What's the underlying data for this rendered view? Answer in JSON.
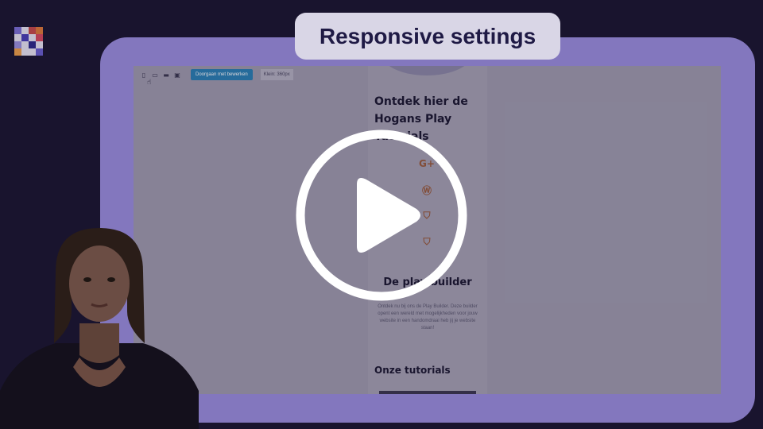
{
  "title": "Responsive settings",
  "toolbar": {
    "icons": [
      "mobile-icon",
      "tablet-icon",
      "laptop-icon",
      "desktop-icon"
    ],
    "continue_label": "Doorgaan met bewerken",
    "width_label": "Klein: 360px"
  },
  "mobile_preview": {
    "heading": "Ontdek hier de Hogans Play Tutorials",
    "social_icons": [
      "google-plus-icon",
      "wordpress-icon",
      "html5-icon",
      "css3-icon"
    ],
    "subheading": "De play builder",
    "paragraph": "Ontdek nu bij ons de Play Builder. Deze builder opent een wereld met mogelijkheden voor jouw website in een handomdraai heb jij je website staan!",
    "section_title": "Onze tutorials"
  },
  "colors": {
    "background": "#1a1530",
    "frame": "#9b8ee0",
    "title_pill": "#d9d6e6",
    "title_text": "#1f1a45",
    "accent_button": "#2a7fb5"
  }
}
